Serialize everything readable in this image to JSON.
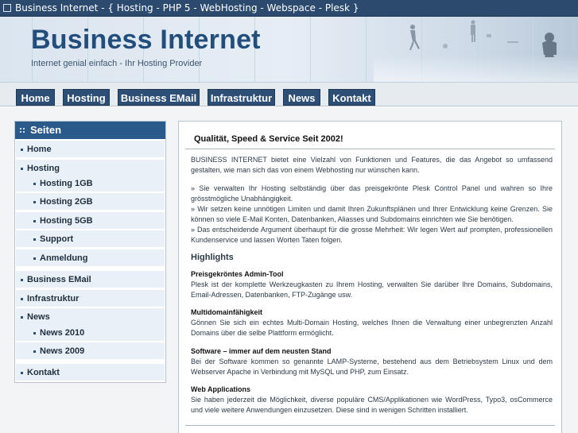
{
  "window": {
    "title": "Business Internet - { Hosting - PHP 5 - WebHosting - Webspace - Plesk }"
  },
  "banner": {
    "title": "Business Internet",
    "subtitle": "Internet genial einfach - Ihr Hosting Provider"
  },
  "nav": {
    "items": [
      {
        "label": "Home"
      },
      {
        "label": "Hosting"
      },
      {
        "label": "Business EMail"
      },
      {
        "label": "Infrastruktur"
      },
      {
        "label": "News"
      },
      {
        "label": "Kontakt"
      }
    ]
  },
  "sidebar": {
    "heading": "Seiten",
    "items": [
      {
        "label": "Home",
        "level": 1
      },
      {
        "label": "Hosting",
        "level": 1
      },
      {
        "label": "Hosting 1GB",
        "level": 2
      },
      {
        "label": "Hosting 2GB",
        "level": 2
      },
      {
        "label": "Hosting 5GB",
        "level": 2
      },
      {
        "label": "Support",
        "level": 2
      },
      {
        "label": "Anmeldung",
        "level": 2
      },
      {
        "label": "Business EMail",
        "level": 1
      },
      {
        "label": "Infrastruktur",
        "level": 1
      },
      {
        "label": "News",
        "level": 1
      },
      {
        "label": "News 2010",
        "level": 2
      },
      {
        "label": "News 2009",
        "level": 2
      },
      {
        "label": "Kontakt",
        "level": 1
      }
    ]
  },
  "content": {
    "title": "Qualität, Speed & Service Seit 2002!",
    "intro": "BUSINESS INTERNET bietet eine Vielzahl von Funktionen und Features, die das Angebot so umfassend gestalten, wie man sich das von einem Webhosting nur wünschen kann.",
    "bullets": "» Sie verwalten Ihr Hosting selbständig über das preisgekrönte Plesk Control Panel und wahren so Ihre grösstmögliche Unabhängigkeit.\n» Wir setzen keine unnötigen Limiten und damit Ihren Zukunftsplänen und Ihrer Entwicklung keine Grenzen. Sie können so viele E-Mail Konten, Datenbanken, Aliasses und Subdomains einrichten wie Sie benötigen.\n» Das entscheidende Argument überhaupt für die grosse Mehrheit: Wir legen Wert auf prompten, professionellen Kundenservice und lassen Worten Taten folgen.",
    "highlights_heading": "Highlights",
    "highlights": [
      {
        "title": "Preisgekröntes Admin-Tool",
        "text": "Plesk ist der komplette Werkzeugkasten zu Ihrem Hosting, verwalten Sie darüber Ihre Domains, Subdomains, Email-Adressen, Datenbanken, FTP-Zugänge usw."
      },
      {
        "title": "Multidomainfähigkeit",
        "text": "Gönnen Sie sich ein echtes Multi-Domain Hosting, welches Ihnen die Verwaltung einer unbegrenzten Anzahl Domains über die selbe Plattform ermöglicht."
      },
      {
        "title": "Software – immer auf dem neusten Stand",
        "text": "Bei der Software kommen so genannte LAMP-Systeme, bestehend aus dem Betriebsystem Linux und dem Webserver Apache in Verbindung mit MySQL und PHP, zum Einsatz."
      },
      {
        "title": "Web Applications",
        "text": "Sie haben jederzeit die Möglichkeit, diverse populäre CMS/Applikationen wie WordPress, Typo3, osCommerce und viele weitere Anwendungen einzusetzen. Diese sind in wenigen Schritten installiert."
      }
    ]
  },
  "colors": {
    "nav_button": "#2d4f75",
    "sidebar_header": "#2a5a8a",
    "sidebar_item_bg": "#e9f0f7",
    "brand_title": "#234d7b"
  }
}
